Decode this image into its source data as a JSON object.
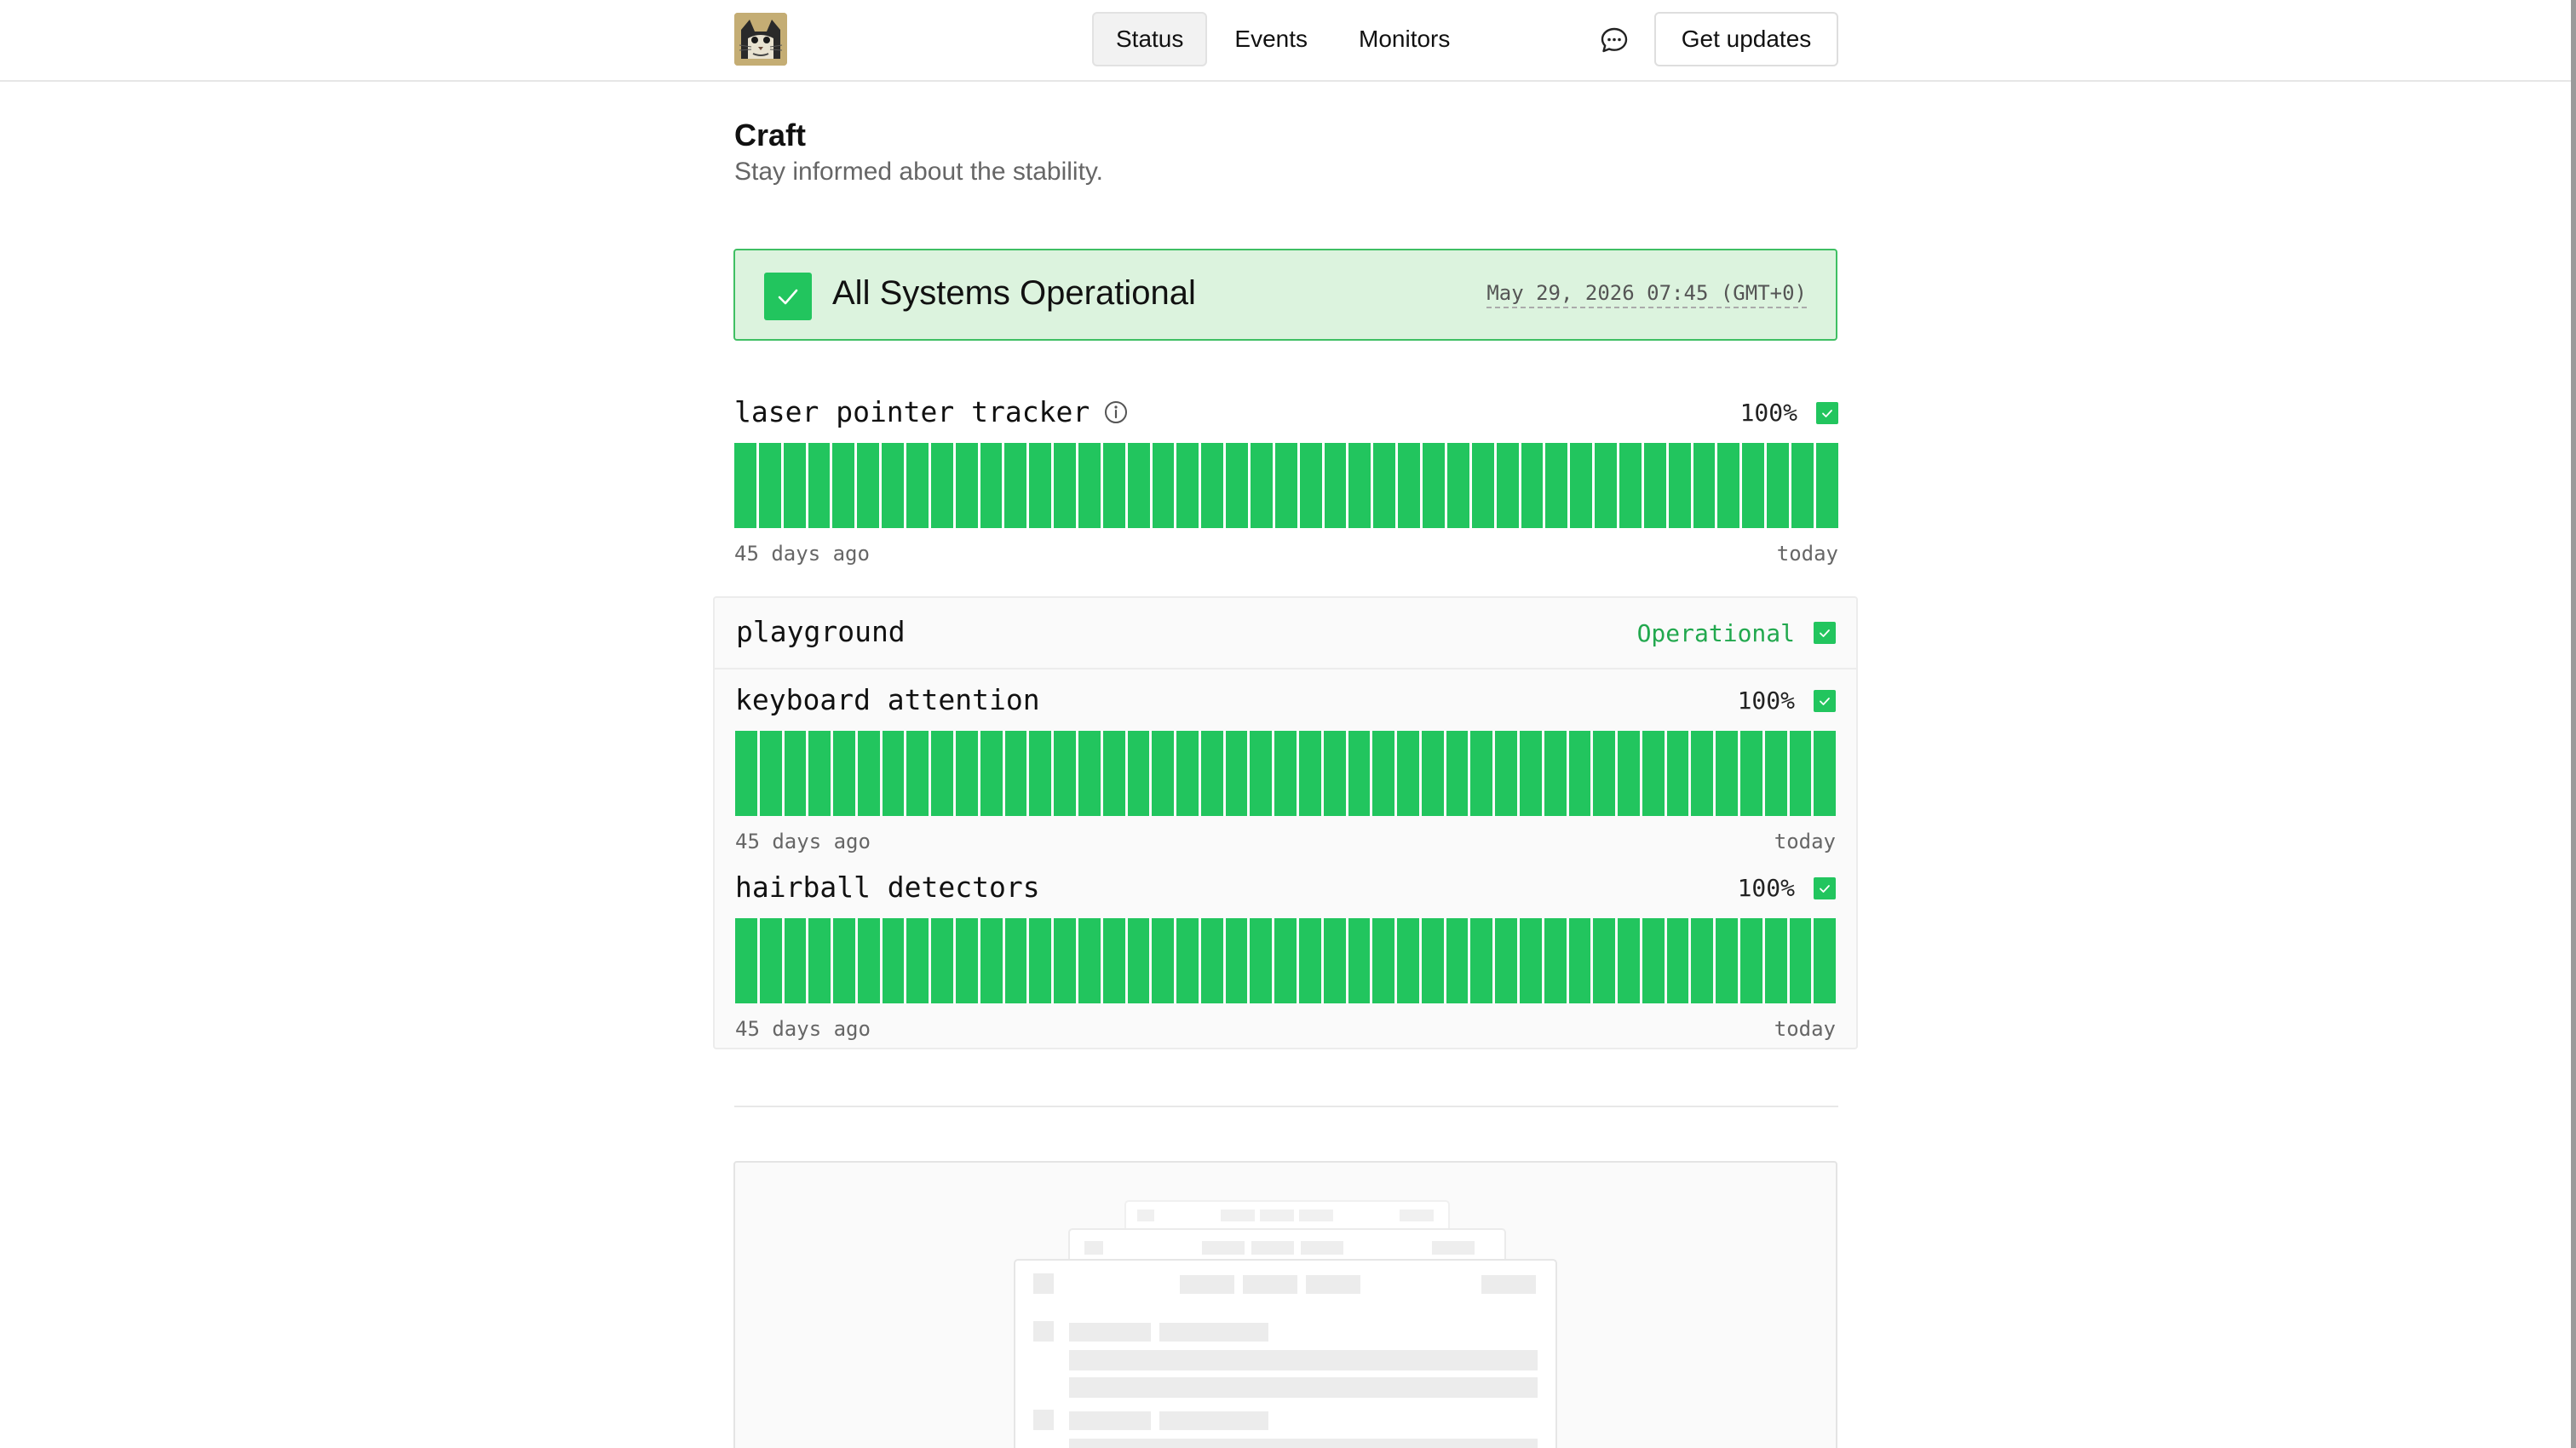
{
  "header": {
    "logo_icon": "cat-avatar-logo",
    "nav": [
      {
        "label": "Status",
        "active": true
      },
      {
        "label": "Events",
        "active": false
      },
      {
        "label": "Monitors",
        "active": false
      }
    ],
    "feedback_icon": "chat-bubble-icon",
    "updates_label": "Get updates"
  },
  "page": {
    "title": "Craft",
    "subtitle": "Stay informed about the stability."
  },
  "banner": {
    "title": "All Systems Operational",
    "timestamp": "May 29, 2026 07:45 (GMT+0)",
    "color": "#22c55e",
    "background": "#dcf3de"
  },
  "monitors": [
    {
      "name": "laser pointer tracker",
      "uptime": "100%",
      "bars": 45,
      "range_start": "45 days ago",
      "range_end": "today"
    }
  ],
  "group": {
    "name": "playground",
    "status": "Operational",
    "monitors": [
      {
        "name": "keyboard attention",
        "uptime": "100%",
        "bars": 45,
        "range_start": "45 days ago",
        "range_end": "today"
      },
      {
        "name": "hairball detectors",
        "uptime": "100%",
        "bars": 45,
        "range_start": "45 days ago",
        "range_end": "today"
      }
    ]
  },
  "colors": {
    "operational": "#22c55e",
    "operational_text": "#22a84e"
  }
}
